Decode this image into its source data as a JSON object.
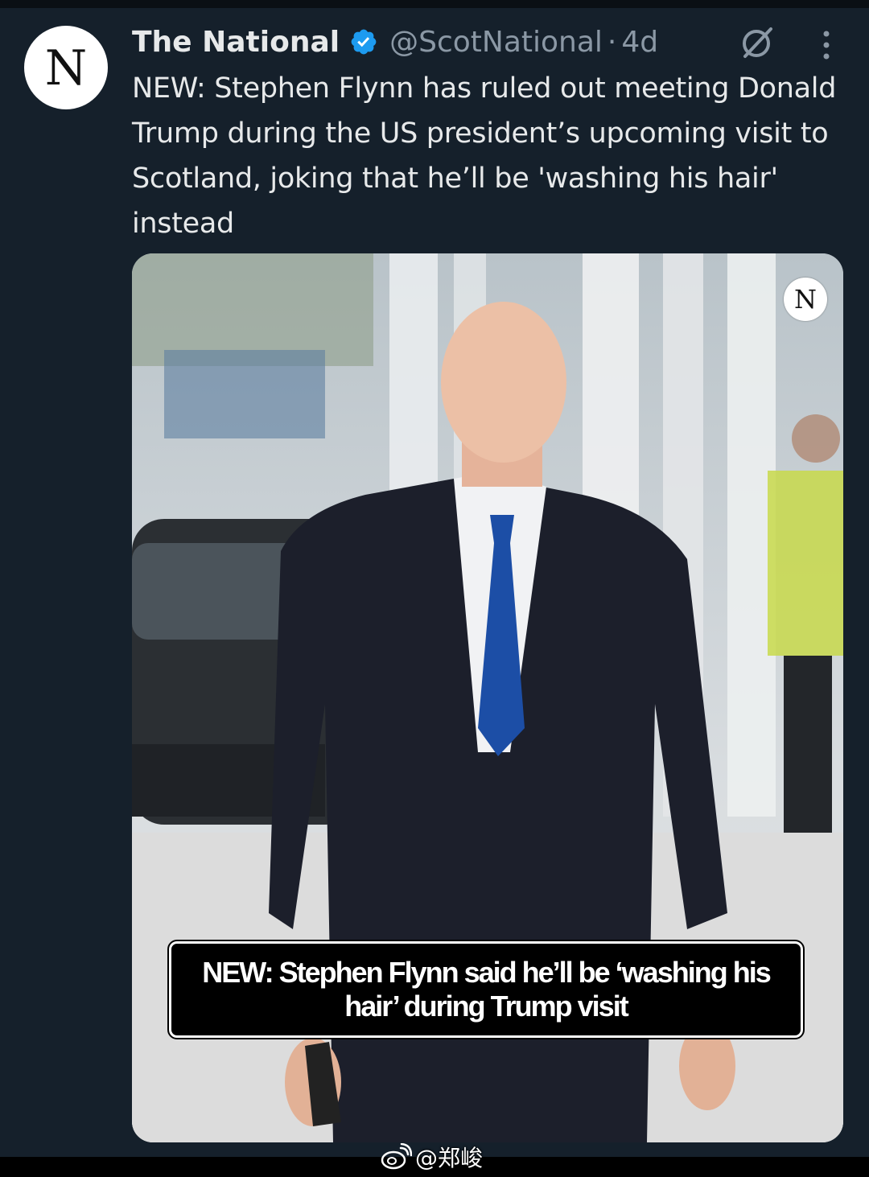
{
  "tweet": {
    "avatar_letter": "N",
    "display_name": "The National",
    "verified": true,
    "handle": "@ScotNational",
    "separator": "·",
    "time": "4d",
    "text": "NEW: Stephen Flynn has ruled out meeting Donald Trump during the US president’s upcoming visit to Scotland, joking that he’ll be 'washing his hair' instead"
  },
  "media": {
    "logo_letter": "N",
    "caption": "NEW: Stephen Flynn said he’ll be ‘washing his hair’ during Trump visit"
  },
  "icons": {
    "verified": "verified-badge-icon",
    "grok": "grok-icon",
    "more": "more-options-icon",
    "watermark": "weibo-icon"
  },
  "watermark": {
    "text": "@郑峻"
  },
  "colors": {
    "background": "#15202b",
    "text_primary": "#e7e9ea",
    "text_secondary": "#8b98a5",
    "verified_blue": "#1d9bf0"
  }
}
